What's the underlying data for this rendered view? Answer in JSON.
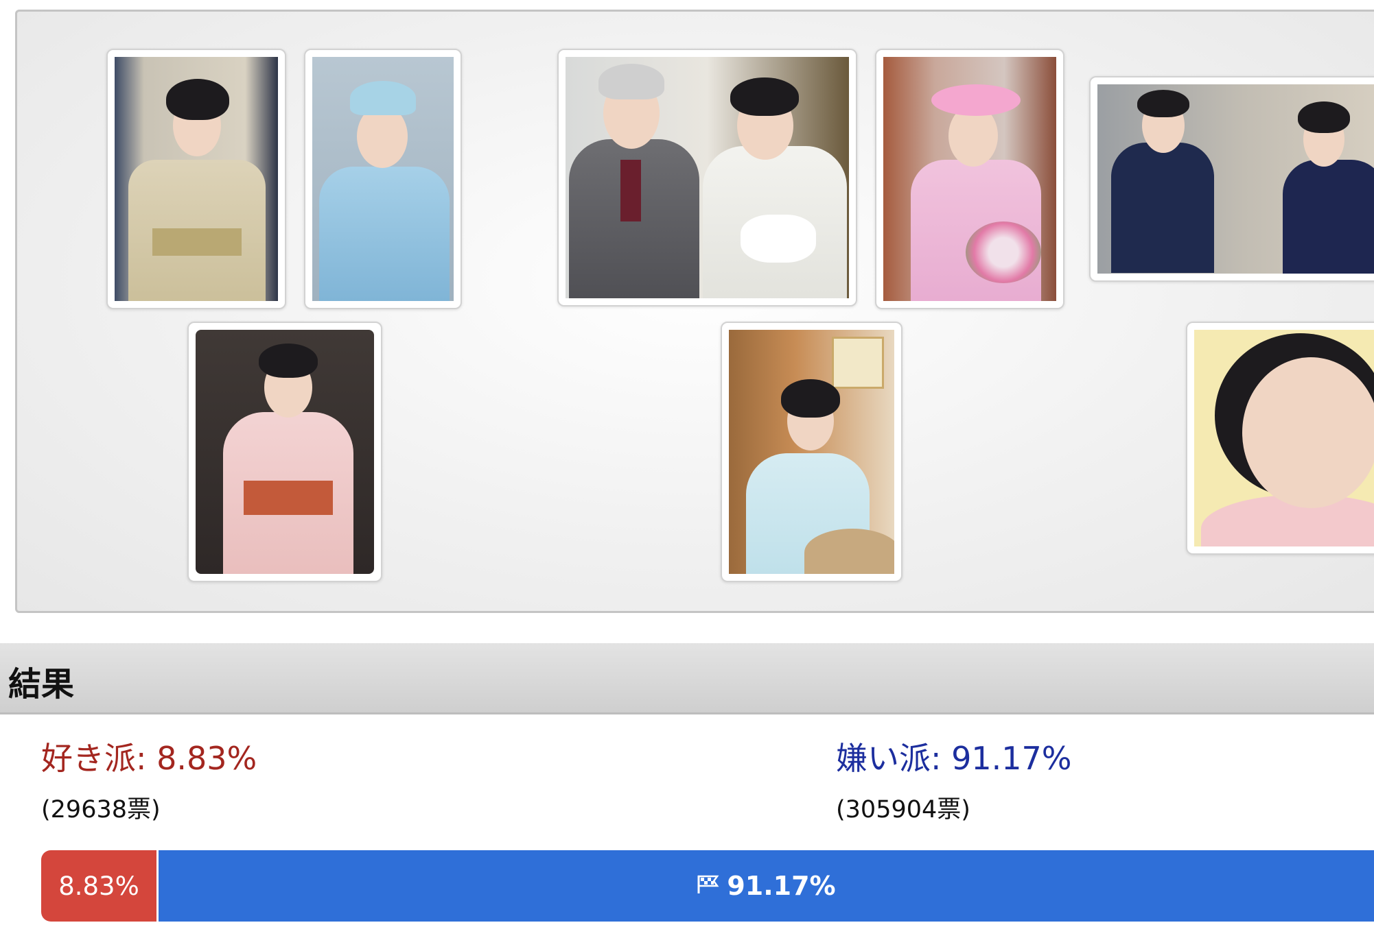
{
  "results": {
    "title": "結果",
    "like": {
      "label": "好き派: 8.83%",
      "count": "(29638票)",
      "percent": 8.83,
      "bar_label": "8.83%",
      "color": "#d4463c"
    },
    "dislike": {
      "label": "嫌い派: 91.17%",
      "count": "(305904票)",
      "percent": 91.17,
      "bar_label": "91.17%",
      "color": "#2f6fd8",
      "icon": "flag-icon"
    }
  },
  "gallery": {
    "photos": [
      {
        "name": "photo-kimono-beige"
      },
      {
        "name": "photo-blue-hat"
      },
      {
        "name": "photo-couple-with-baby"
      },
      {
        "name": "photo-pink-hat-bouquet"
      },
      {
        "name": "photo-dark-suits"
      },
      {
        "name": "photo-pink-kimono"
      },
      {
        "name": "photo-seated-light-blue"
      },
      {
        "name": "photo-portrait-yellow"
      }
    ]
  }
}
